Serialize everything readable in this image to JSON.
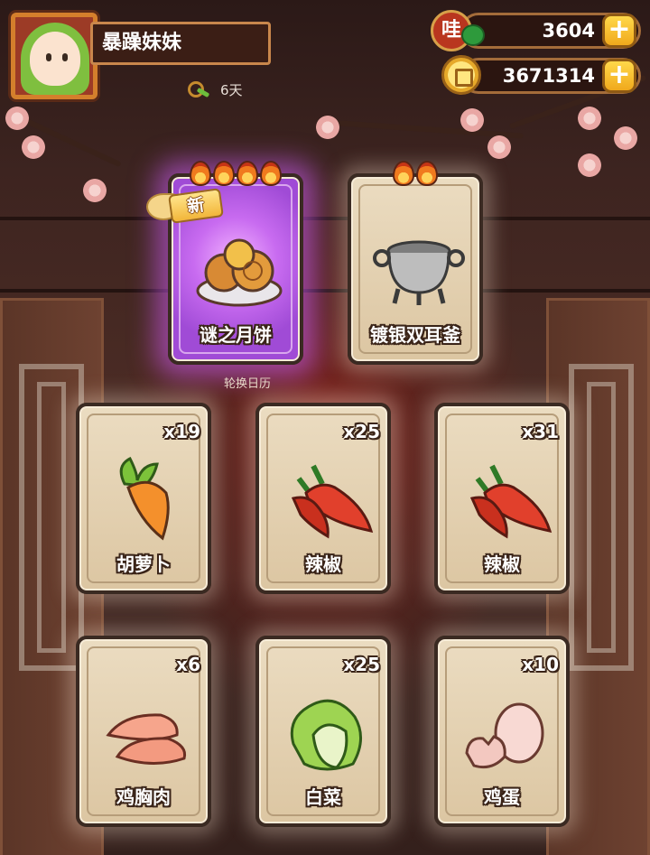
{
  "player": {
    "name": "暴躁妹妹",
    "days": "6天"
  },
  "resources": {
    "wa_currency": "3604",
    "coins": "3671314",
    "wa_icon_text": "哇",
    "plus": "+"
  },
  "rotate_calendar_label": "轮换日历",
  "featured": [
    {
      "name": "谜之月饼",
      "flames": 4,
      "is_new": true,
      "new_label": "新"
    },
    {
      "name": "镀银双耳釜",
      "flames": 2,
      "is_new": false
    }
  ],
  "ingredients": [
    {
      "name": "胡萝卜",
      "count": "x19",
      "icon": "carrot-icon"
    },
    {
      "name": "辣椒",
      "count": "x25",
      "icon": "chili-icon"
    },
    {
      "name": "辣椒",
      "count": "x31",
      "icon": "chili-icon"
    },
    {
      "name": "鸡胸肉",
      "count": "x6",
      "icon": "chicken-breast-icon"
    },
    {
      "name": "白菜",
      "count": "x25",
      "icon": "cabbage-icon"
    },
    {
      "name": "鸡蛋",
      "count": "x10",
      "icon": "egg-icon"
    }
  ],
  "colors": {
    "card_bg": "#e5d3b5",
    "special_glow": "#c86bf0",
    "plus_button": "#f7c12d"
  }
}
